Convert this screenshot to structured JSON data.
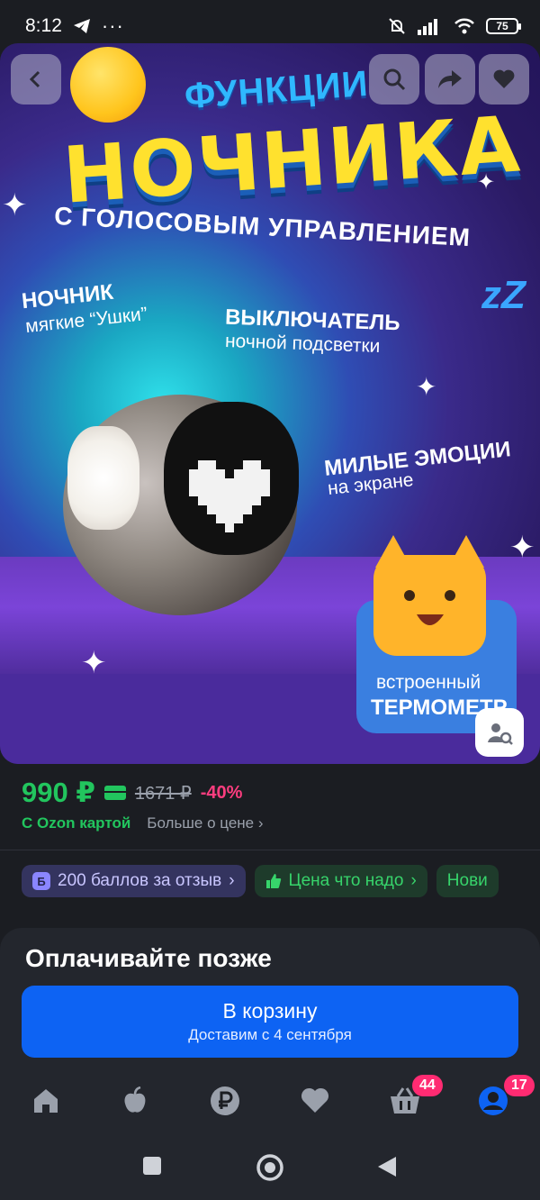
{
  "status_bar": {
    "time": "8:12",
    "battery": "75"
  },
  "hero": {
    "title_line1": "ФУНКЦИИ",
    "title_line2": "НОЧНИКА",
    "subtitle": "С ГОЛОСОВЫМ УПРАВЛЕНИЕМ",
    "callouts": [
      {
        "title": "НОЧНИК",
        "sub": "мягкие “Ушки”"
      },
      {
        "title": "ВЫКЛЮЧАТЕЛЬ",
        "sub": "ночной подсветки"
      },
      {
        "title": "МИЛЫЕ ЭМОЦИИ",
        "sub": "на экране"
      },
      {
        "title": "ТЕРМОМЕТР",
        "sub": "встроенный"
      }
    ],
    "zzz": "zZ"
  },
  "price": {
    "current": "990 ₽",
    "old": "1671 ₽",
    "discount": "-40%",
    "ozon_card": "С Ozon картой",
    "more_link": "Больше о цене"
  },
  "chips": [
    {
      "label": "200 баллов за отзыв",
      "badge": "Б"
    },
    {
      "label": "Цена что надо"
    },
    {
      "label": "Нови"
    }
  ],
  "sheet": {
    "heading": "Оплачивайте позже",
    "cart_button": "В корзину",
    "delivery": "Доставим с 4 сентября"
  },
  "nav": {
    "cart_badge": "44",
    "profile_badge": "17"
  },
  "colors": {
    "accent_green": "#22c55e",
    "accent_blue": "#0d63f3",
    "discount_pink": "#ff3d7f"
  }
}
